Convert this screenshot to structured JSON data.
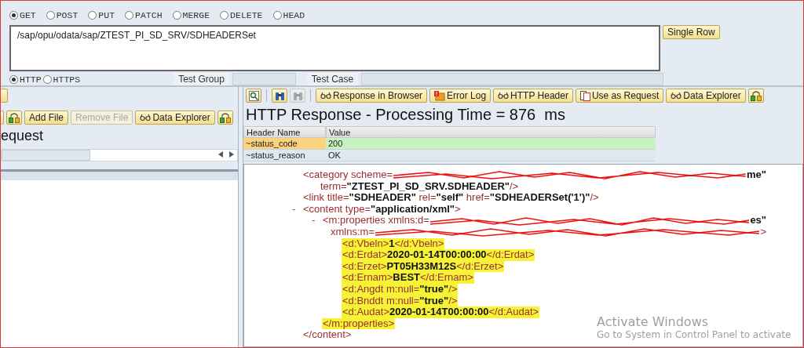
{
  "request": {
    "methods": [
      {
        "label": "GET",
        "selected": true
      },
      {
        "label": "POST",
        "selected": false
      },
      {
        "label": "PUT",
        "selected": false
      },
      {
        "label": "PATCH",
        "selected": false
      },
      {
        "label": "MERGE",
        "selected": false
      },
      {
        "label": "DELETE",
        "selected": false
      },
      {
        "label": "HEAD",
        "selected": false
      }
    ],
    "url": "/sap/opu/odata/sap/ZTEST_PI_SD_SRV/SDHEADERSet",
    "single_row_button": "Single Row",
    "protocols": [
      {
        "label": "HTTP",
        "selected": true
      },
      {
        "label": "HTTPS",
        "selected": false
      }
    ],
    "test_group_label": "Test Group",
    "test_case_label": "Test Case"
  },
  "request_panel": {
    "toolbar": [
      {
        "kind": "transport",
        "disabled": false
      },
      {
        "kind": "text",
        "label": "Add File",
        "disabled": false
      },
      {
        "kind": "text",
        "label": "Remove File",
        "disabled": true
      },
      {
        "kind": "glasses",
        "label": "Data Explorer",
        "disabled": false
      },
      {
        "kind": "transport",
        "disabled": false
      }
    ],
    "title": "equest"
  },
  "response_panel": {
    "toolbar": [
      {
        "kind": "find",
        "disabled": false
      },
      {
        "kind": "separator"
      },
      {
        "kind": "binoculars",
        "disabled": false
      },
      {
        "kind": "binoculars",
        "disabled": true
      },
      {
        "kind": "separator"
      },
      {
        "kind": "glasses",
        "label": "Response in Browser",
        "disabled": false
      },
      {
        "kind": "error",
        "label": "Error Log",
        "disabled": false
      },
      {
        "kind": "glasses",
        "label": "HTTP Header",
        "disabled": false
      },
      {
        "kind": "document",
        "label": "Use as Request",
        "disabled": false
      },
      {
        "kind": "glasses",
        "label": "Data Explorer",
        "disabled": false
      },
      {
        "kind": "transport",
        "disabled": false
      }
    ],
    "title": "HTTP Response - Processing Time = 876  ms",
    "header_table": {
      "columns": [
        "Header Name",
        "Value"
      ],
      "rows": [
        {
          "cells": [
            "~status_code",
            "200"
          ],
          "selected": true
        },
        {
          "cells": [
            "~status_reason",
            "OK"
          ],
          "selected": false
        }
      ]
    },
    "xml": {
      "nodes": [
        {
          "lines": [
            {
              "highlighted": false,
              "tokens": [
                {
                  "kind": "markup",
                  "text": "<category scheme="
                },
                {
                  "kind": "redacted"
                },
                {
                  "kind": "value",
                  "text": "me\""
                }
              ]
            },
            {
              "highlighted": false,
              "tokens": [
                {
                  "kind": "markup",
                  "text": "term="
                },
                {
                  "kind": "value",
                  "text": "\"ZTEST_PI_SD_SRV.SDHEADER\""
                },
                {
                  "kind": "markup",
                  "text": "/>"
                }
              ]
            }
          ]
        },
        {
          "lines": [
            {
              "highlighted": false,
              "tokens": [
                {
                  "kind": "markup",
                  "text": "<link title="
                },
                {
                  "kind": "value",
                  "text": "\"SDHEADER\""
                },
                {
                  "kind": "markup",
                  "text": " rel="
                },
                {
                  "kind": "value",
                  "text": "\"self\""
                },
                {
                  "kind": "markup",
                  "text": " href="
                },
                {
                  "kind": "value",
                  "text": "\"SDHEADERSet('1')\""
                },
                {
                  "kind": "markup",
                  "text": "/>"
                }
              ]
            }
          ]
        },
        {
          "toggle": "-",
          "lines": [
            {
              "highlighted": false,
              "tokens": [
                {
                  "kind": "markup",
                  "text": "<content type="
                },
                {
                  "kind": "value",
                  "text": "\"application/xml\""
                },
                {
                  "kind": "markup",
                  "text": ">"
                }
              ]
            }
          ],
          "children": [
            {
              "toggle": "-",
              "lines": [
                {
                  "highlighted": false,
                  "tokens": [
                    {
                      "kind": "markup",
                      "text": "<m:properties xmlns:d="
                    },
                    {
                      "kind": "redacted"
                    },
                    {
                      "kind": "value",
                      "text": "es\""
                    }
                  ]
                },
                {
                  "highlighted": false,
                  "tokens": [
                    {
                      "kind": "markup",
                      "text": "xmlns:m="
                    },
                    {
                      "kind": "redacted"
                    },
                    {
                      "kind": "markup",
                      "text": ">"
                    }
                  ]
                }
              ],
              "children": [
                {
                  "lines": [
                    {
                      "highlighted": true,
                      "tokens": [
                        {
                          "kind": "markup",
                          "text": "<d:Vbeln>"
                        },
                        {
                          "kind": "value",
                          "text": "1"
                        },
                        {
                          "kind": "markup",
                          "text": "</d:Vbeln>"
                        }
                      ]
                    }
                  ]
                },
                {
                  "lines": [
                    {
                      "highlighted": true,
                      "tokens": [
                        {
                          "kind": "markup",
                          "text": "<d:Erdat>"
                        },
                        {
                          "kind": "value",
                          "text": "2020-01-14T00:00:00"
                        },
                        {
                          "kind": "markup",
                          "text": "</d:Erdat>"
                        }
                      ]
                    }
                  ]
                },
                {
                  "lines": [
                    {
                      "highlighted": true,
                      "tokens": [
                        {
                          "kind": "markup",
                          "text": "<d:Erzet>"
                        },
                        {
                          "kind": "value",
                          "text": "PT05H33M12S"
                        },
                        {
                          "kind": "markup",
                          "text": "</d:Erzet>"
                        }
                      ]
                    }
                  ]
                },
                {
                  "lines": [
                    {
                      "highlighted": true,
                      "tokens": [
                        {
                          "kind": "markup",
                          "text": "<d:Ernam>"
                        },
                        {
                          "kind": "value",
                          "text": "BEST"
                        },
                        {
                          "kind": "markup",
                          "text": "</d:Ernam>"
                        }
                      ]
                    }
                  ]
                },
                {
                  "lines": [
                    {
                      "highlighted": true,
                      "tokens": [
                        {
                          "kind": "markup",
                          "text": "<d:Angdt m:null="
                        },
                        {
                          "kind": "value",
                          "text": "\"true\""
                        },
                        {
                          "kind": "markup",
                          "text": "/>"
                        }
                      ]
                    }
                  ]
                },
                {
                  "lines": [
                    {
                      "highlighted": true,
                      "tokens": [
                        {
                          "kind": "markup",
                          "text": "<d:Bnddt m:null="
                        },
                        {
                          "kind": "value",
                          "text": "\"true\""
                        },
                        {
                          "kind": "markup",
                          "text": "/>"
                        }
                      ]
                    }
                  ]
                },
                {
                  "lines": [
                    {
                      "highlighted": true,
                      "tokens": [
                        {
                          "kind": "markup",
                          "text": "<d:Audat>"
                        },
                        {
                          "kind": "value",
                          "text": "2020-01-14T00:00:00"
                        },
                        {
                          "kind": "markup",
                          "text": "</d:Audat>"
                        }
                      ]
                    }
                  ]
                }
              ],
              "close": {
                "highlighted": true,
                "tokens": [
                  {
                    "kind": "markup",
                    "text": "</m:properties>"
                  }
                ]
              }
            }
          ],
          "close": {
            "highlighted": false,
            "tokens": [
              {
                "kind": "markup",
                "text": "</content>"
              }
            ]
          }
        }
      ]
    }
  },
  "os_notice": {
    "title": "Activate Windows",
    "subtitle": "Go to System in Control Panel to activate"
  }
}
